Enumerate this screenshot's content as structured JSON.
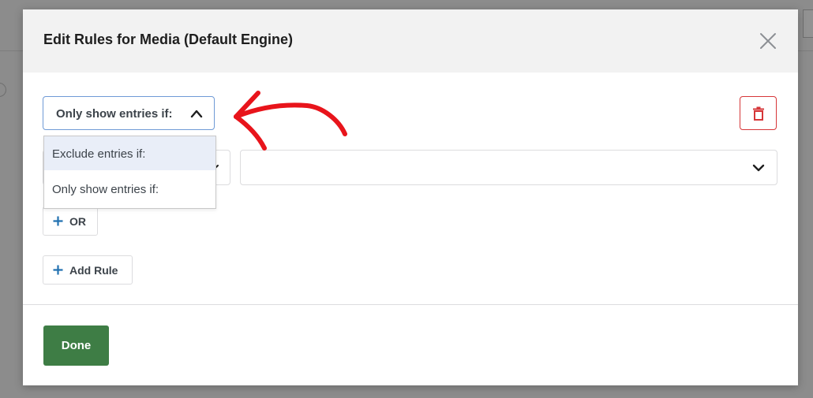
{
  "modal": {
    "title": "Edit Rules for Media (Default Engine)",
    "close_icon": "close-icon"
  },
  "rule": {
    "selected": "Only show entries if:",
    "dropdown_open": true,
    "options": [
      "Exclude entries if:",
      "Only show entries if:"
    ],
    "highlighted_option": "Exclude entries if:",
    "field_value": "",
    "value_value": ""
  },
  "buttons": {
    "or_label": "OR",
    "add_rule_label": "Add Rule",
    "done_label": "Done",
    "trash_icon": "trash-icon",
    "plus_icon": "plus-icon"
  },
  "colors": {
    "accent": "#2271b1",
    "primary_button": "#3e7d45",
    "danger": "#d63638",
    "annotation": "#e8141b"
  }
}
